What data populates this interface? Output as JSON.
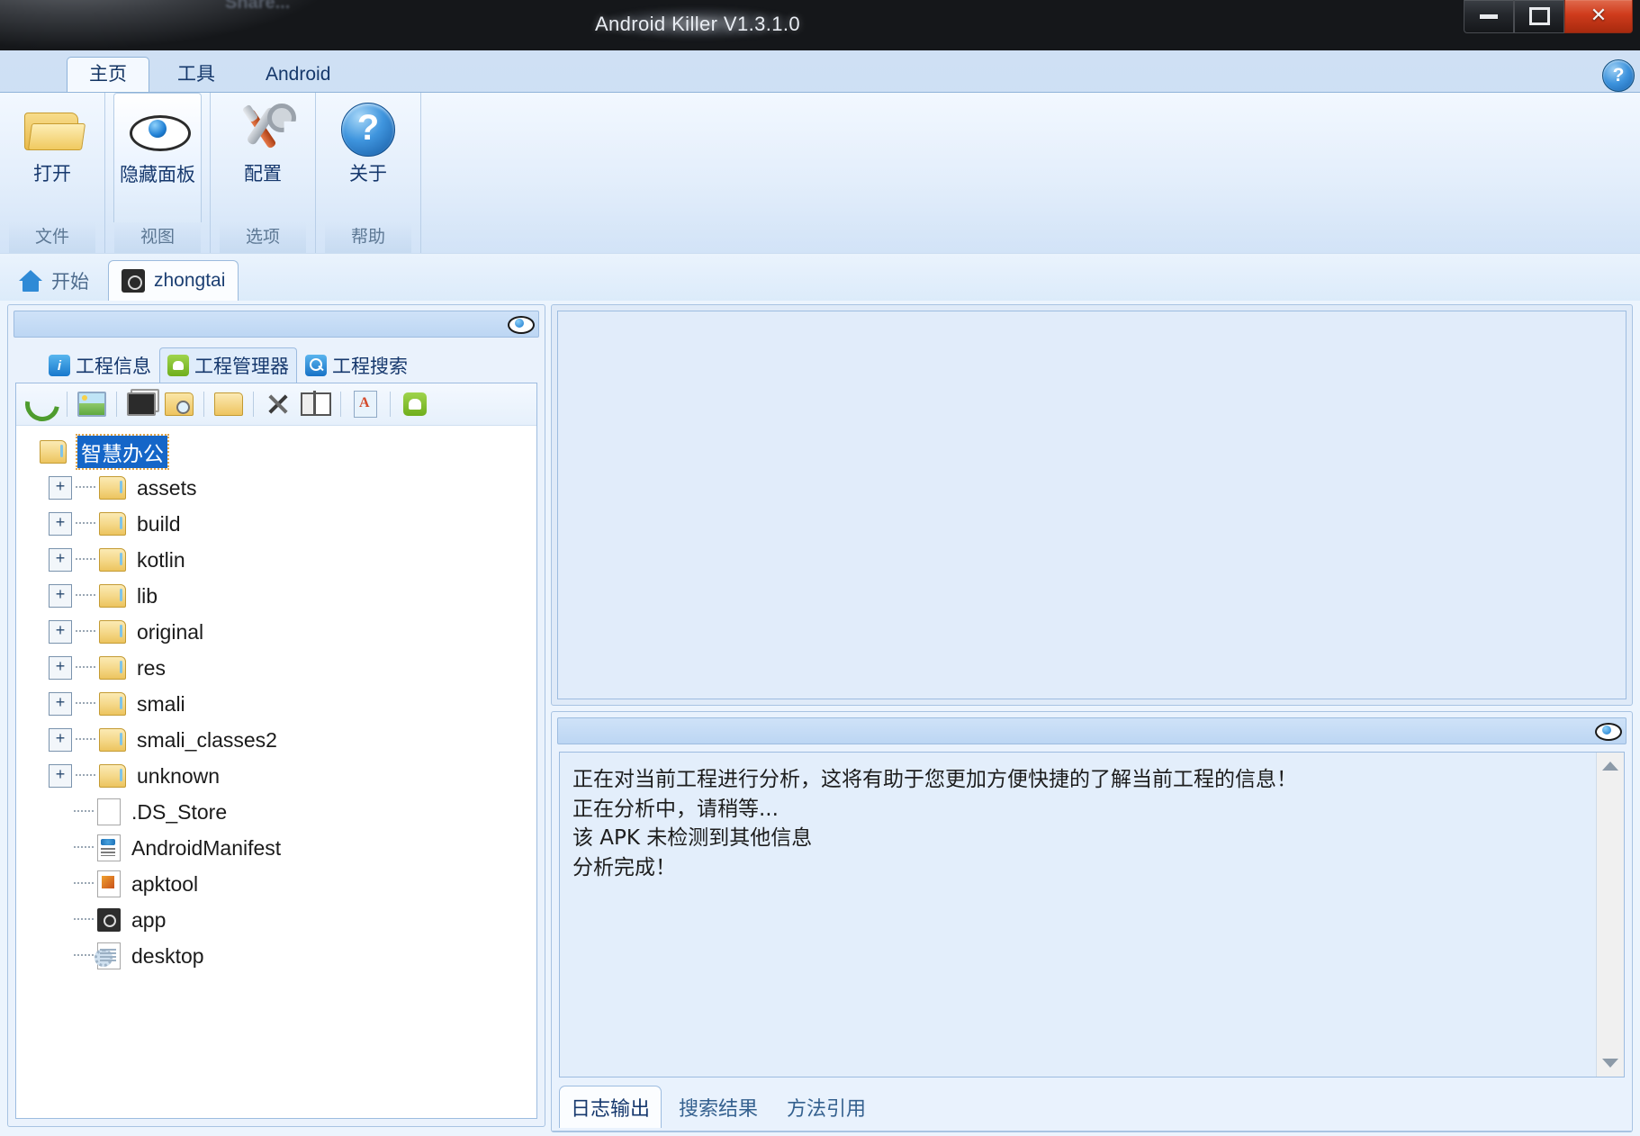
{
  "window": {
    "title": "Android Killer V1.3.1.0",
    "behind_text": "Share...",
    "controls": {
      "minimize": "minimize-button",
      "maximize": "maximize-button",
      "close": "✕"
    }
  },
  "ribbon": {
    "tabs": [
      {
        "label": "主页",
        "active": true
      },
      {
        "label": "工具",
        "active": false
      },
      {
        "label": "Android",
        "active": false
      }
    ],
    "help_label": "?",
    "groups": [
      {
        "button": "打开",
        "group": "文件",
        "icon": "open-folder-icon",
        "selected": false
      },
      {
        "button": "隐藏面板",
        "group": "视图",
        "icon": "eye-icon",
        "selected": true
      },
      {
        "button": "配置",
        "group": "选项",
        "icon": "tools-icon",
        "selected": false
      },
      {
        "button": "关于",
        "group": "帮助",
        "icon": "question-mark-icon",
        "selected": false
      }
    ]
  },
  "doc_tabs": [
    {
      "label": "开始",
      "icon": "home-icon",
      "active": false
    },
    {
      "label": "zhongtai",
      "icon": "app-icon",
      "active": true
    }
  ],
  "left_panel": {
    "eye_icon": "eye-icon",
    "tabs": [
      {
        "label": "工程信息",
        "icon": "info-icon",
        "active": false
      },
      {
        "label": "工程管理器",
        "icon": "android-icon",
        "active": true
      },
      {
        "label": "工程搜索",
        "icon": "search-icon",
        "active": false
      }
    ],
    "toolbar": [
      "refresh-icon",
      "image-icon",
      "screen-icon",
      "folder-search-icon",
      "folder-icon",
      "scissors-icon",
      "collapse-icon",
      "document-a-icon",
      "android-icon"
    ],
    "tree": [
      {
        "label": "智慧办公",
        "type": "folder",
        "level": 0,
        "expanded": true,
        "selected": true
      },
      {
        "label": "assets",
        "type": "folder",
        "level": 1,
        "expanded": false,
        "selected": false
      },
      {
        "label": "build",
        "type": "folder",
        "level": 1,
        "expanded": false,
        "selected": false
      },
      {
        "label": "kotlin",
        "type": "folder",
        "level": 1,
        "expanded": false,
        "selected": false
      },
      {
        "label": "lib",
        "type": "folder",
        "level": 1,
        "expanded": false,
        "selected": false
      },
      {
        "label": "original",
        "type": "folder",
        "level": 1,
        "expanded": false,
        "selected": false
      },
      {
        "label": "res",
        "type": "folder",
        "level": 1,
        "expanded": false,
        "selected": false
      },
      {
        "label": "smali",
        "type": "folder",
        "level": 1,
        "expanded": false,
        "selected": false
      },
      {
        "label": "smali_classes2",
        "type": "folder",
        "level": 1,
        "expanded": false,
        "selected": false
      },
      {
        "label": "unknown",
        "type": "folder",
        "level": 1,
        "expanded": false,
        "selected": false
      },
      {
        "label": ".DS_Store",
        "type": "file-plain",
        "level": 1,
        "expanded": null,
        "selected": false
      },
      {
        "label": "AndroidManifest",
        "type": "file-xml",
        "level": 1,
        "expanded": null,
        "selected": false
      },
      {
        "label": "apktool",
        "type": "file-yml",
        "level": 1,
        "expanded": null,
        "selected": false
      },
      {
        "label": "app",
        "type": "file-app",
        "level": 1,
        "expanded": null,
        "selected": false
      },
      {
        "label": "desktop",
        "type": "file-ini",
        "level": 1,
        "expanded": null,
        "selected": false
      }
    ]
  },
  "log_panel": {
    "eye_icon": "eye-icon",
    "lines": [
      "正在对当前工程进行分析，这将有助于您更加方便快捷的了解当前工程的信息！",
      "正在分析中，请稍等...",
      "该 APK 未检测到其他信息",
      "分析完成！"
    ],
    "text": "正在对当前工程进行分析，这将有助于您更加方便快捷的了解当前工程的信息！\n正在分析中，请稍等...\n该 APK 未检测到其他信息\n分析完成！",
    "tabs": [
      {
        "label": "日志输出",
        "active": true
      },
      {
        "label": "搜索结果",
        "active": false
      },
      {
        "label": "方法引用",
        "active": false
      }
    ]
  },
  "colors": {
    "accent_blue": "#1566c8",
    "ribbon_bg": "#cfe0f4",
    "panel_bg": "#e3eefb",
    "close_red": "#cf3b1c",
    "android_green": "#6fae1c"
  }
}
